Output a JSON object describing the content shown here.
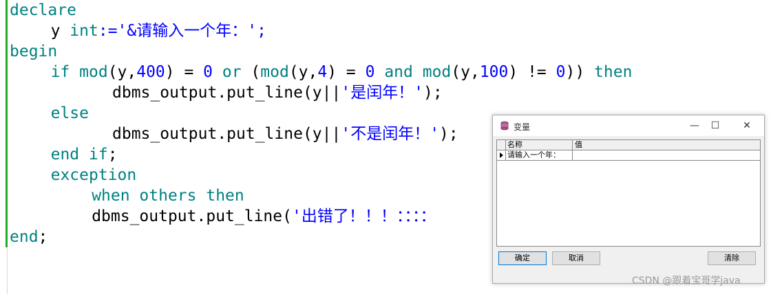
{
  "editor": {
    "lines": [
      {
        "indent": 0,
        "parts": [
          {
            "t": "declare",
            "c": "kw"
          }
        ]
      },
      {
        "indent": 2,
        "parts": [
          {
            "t": "y ",
            "c": "fn"
          },
          {
            "t": "int",
            "c": "kw"
          },
          {
            "t": ":='&请输入一个年：';",
            "c": "str"
          }
        ]
      },
      {
        "indent": 0,
        "parts": [
          {
            "t": "begin",
            "c": "kw"
          }
        ]
      },
      {
        "indent": 2,
        "parts": [
          {
            "t": "if ",
            "c": "kw"
          },
          {
            "t": "mod",
            "c": "kw"
          },
          {
            "t": "(y,",
            "c": "fn"
          },
          {
            "t": "400",
            "c": "num"
          },
          {
            "t": ") = ",
            "c": "fn"
          },
          {
            "t": "0",
            "c": "num"
          },
          {
            "t": " or ",
            "c": "kw"
          },
          {
            "t": "(",
            "c": "fn"
          },
          {
            "t": "mod",
            "c": "kw"
          },
          {
            "t": "(y,",
            "c": "fn"
          },
          {
            "t": "4",
            "c": "num"
          },
          {
            "t": ") = ",
            "c": "fn"
          },
          {
            "t": "0",
            "c": "num"
          },
          {
            "t": " and ",
            "c": "kw"
          },
          {
            "t": "mod",
            "c": "kw"
          },
          {
            "t": "(y,",
            "c": "fn"
          },
          {
            "t": "100",
            "c": "num"
          },
          {
            "t": ") != ",
            "c": "fn"
          },
          {
            "t": "0",
            "c": "num"
          },
          {
            "t": ")) ",
            "c": "fn"
          },
          {
            "t": "then",
            "c": "kw"
          }
        ]
      },
      {
        "indent": 5,
        "parts": [
          {
            "t": "dbms_output.put_line(y||",
            "c": "fn"
          },
          {
            "t": "'是闰年！'",
            "c": "str"
          },
          {
            "t": ");",
            "c": "fn"
          }
        ]
      },
      {
        "indent": 2,
        "parts": [
          {
            "t": "else",
            "c": "kw"
          }
        ]
      },
      {
        "indent": 5,
        "parts": [
          {
            "t": "dbms_output.put_line(y||",
            "c": "fn"
          },
          {
            "t": "'不是闰年！'",
            "c": "str"
          },
          {
            "t": ");",
            "c": "fn"
          }
        ]
      },
      {
        "indent": 2,
        "parts": [
          {
            "t": "end if",
            "c": "kw"
          },
          {
            "t": ";",
            "c": "fn"
          }
        ]
      },
      {
        "indent": 2,
        "parts": [
          {
            "t": "exception",
            "c": "kw"
          }
        ]
      },
      {
        "indent": 4,
        "parts": [
          {
            "t": "when others then",
            "c": "kw"
          }
        ]
      },
      {
        "indent": 4,
        "parts": [
          {
            "t": "dbms_output.put_line(",
            "c": "fn"
          },
          {
            "t": "'出错了！！！：：：：",
            "c": "str"
          }
        ]
      },
      {
        "indent": 0,
        "parts": [
          {
            "t": "end",
            "c": "kw"
          },
          {
            "t": ";",
            "c": "fn"
          }
        ]
      }
    ]
  },
  "dialog": {
    "title": "变量",
    "minimize": "—",
    "maximize": "☐",
    "close": "✕",
    "grid": {
      "col_name": "名称",
      "col_value": "值",
      "rows": [
        {
          "name": "请输入一个年：",
          "value": ""
        }
      ]
    },
    "ok_label": "确定",
    "cancel_label": "取消",
    "clear_label": "清除"
  },
  "watermark": "CSDN @跟着宝哥学java",
  "colors": {
    "keyword": "#008080",
    "literal": "#0000ff",
    "gutter_bar": "#22aa22"
  }
}
